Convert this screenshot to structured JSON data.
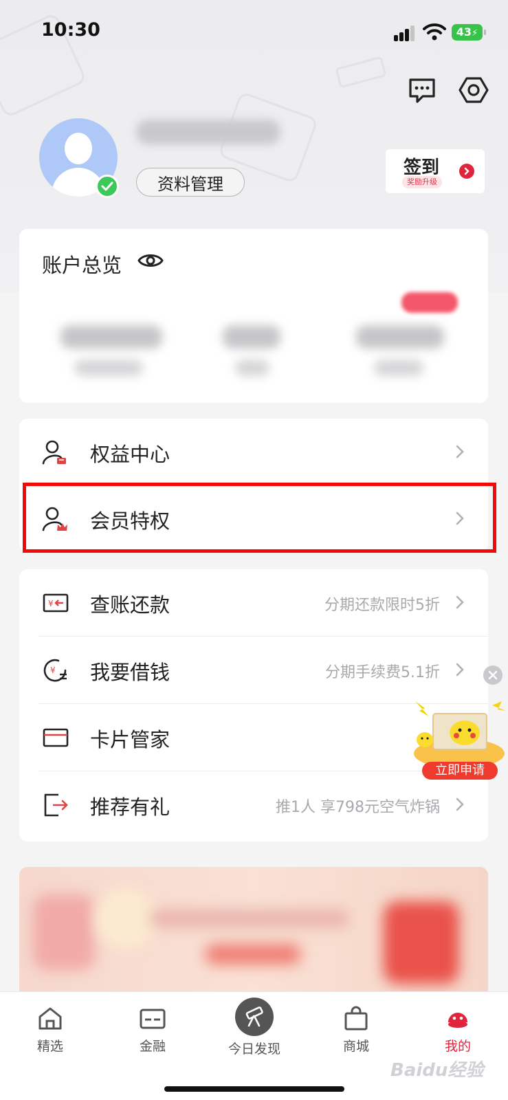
{
  "status_bar": {
    "time": "10:30",
    "battery": "43"
  },
  "profile": {
    "manage_label": "资料管理"
  },
  "checkin": {
    "title": "签到",
    "subtitle": "奖励升级"
  },
  "account": {
    "title": "账户总览"
  },
  "menu_top": [
    {
      "label": "权益中心",
      "icon": "user-card-icon"
    },
    {
      "label": "会员特权",
      "icon": "user-crown-icon"
    }
  ],
  "menu_main": [
    {
      "label": "查账还款",
      "hint": "分期还款限时5折",
      "icon": "bill-icon"
    },
    {
      "label": "我要借钱",
      "hint": "分期手续费5.1折",
      "icon": "loan-icon"
    },
    {
      "label": "卡片管家",
      "hint": "",
      "icon": "card-icon"
    },
    {
      "label": "推荐有礼",
      "hint": "推1人 享798元空气炸锅",
      "icon": "share-icon"
    }
  ],
  "float_ad": {
    "button": "立即申请"
  },
  "tabbar": [
    {
      "label": "精选",
      "icon": "home-icon"
    },
    {
      "label": "金融",
      "icon": "card-icon"
    },
    {
      "label": "今日发现",
      "icon": "telescope-icon"
    },
    {
      "label": "商城",
      "icon": "bag-icon"
    },
    {
      "label": "我的",
      "icon": "profile-icon"
    }
  ],
  "watermark": "Baidu经验",
  "colors": {
    "accent": "#e0243b",
    "highlight": "#f10a0a",
    "verified": "#3dc85a"
  }
}
